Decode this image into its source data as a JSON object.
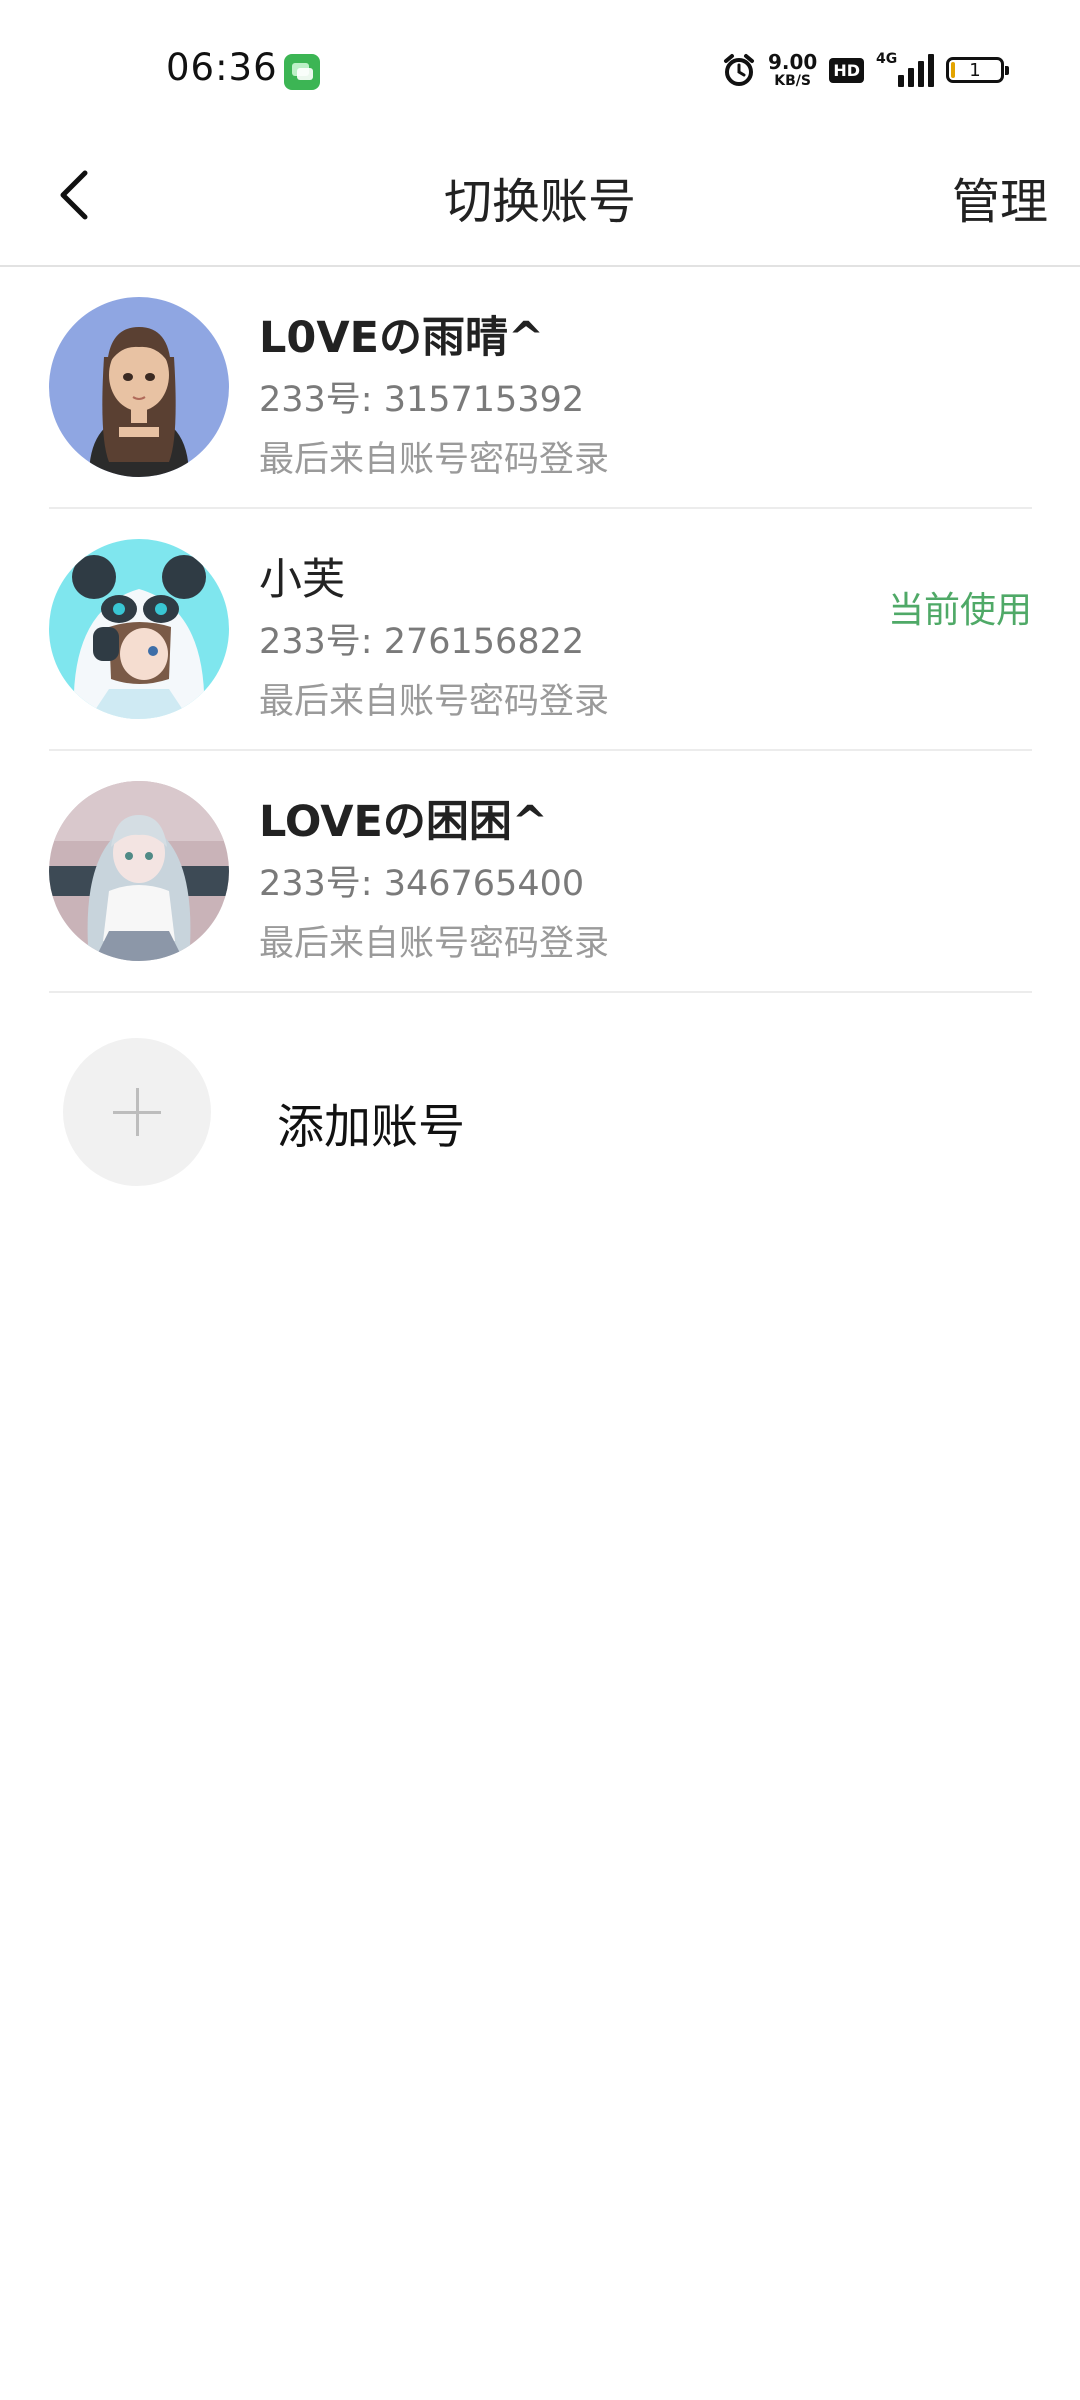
{
  "status_bar": {
    "time": "06:36",
    "net_speed_value": "9.00",
    "net_speed_unit": "KB/S",
    "hd_badge": "HD",
    "network_type": "4G",
    "battery_level": "1"
  },
  "header": {
    "title": "切换账号",
    "manage_label": "管理"
  },
  "accounts": [
    {
      "name": "L0VEの雨晴^",
      "id_text": "233号: 315715392",
      "login_text": "最后来自账号密码登录",
      "current_label": ""
    },
    {
      "name": "小芙",
      "id_text": "233号: 276156822",
      "login_text": "最后来自账号密码登录",
      "current_label": "当前使用"
    },
    {
      "name": "LOVEの困困^",
      "id_text": "233号: 346765400",
      "login_text": "最后来自账号密码登录",
      "current_label": ""
    }
  ],
  "add_account": {
    "label": "添加账号"
  },
  "colors": {
    "current_label": "#4fa967",
    "divider": "#ececec",
    "secondary_text": "#7a7a7a"
  },
  "icons": {
    "back": "chevron-left-icon",
    "add": "plus-icon",
    "status_message": "message-icon",
    "status_alarm": "alarm-icon",
    "status_signal": "signal-icon",
    "status_battery": "battery-icon"
  }
}
